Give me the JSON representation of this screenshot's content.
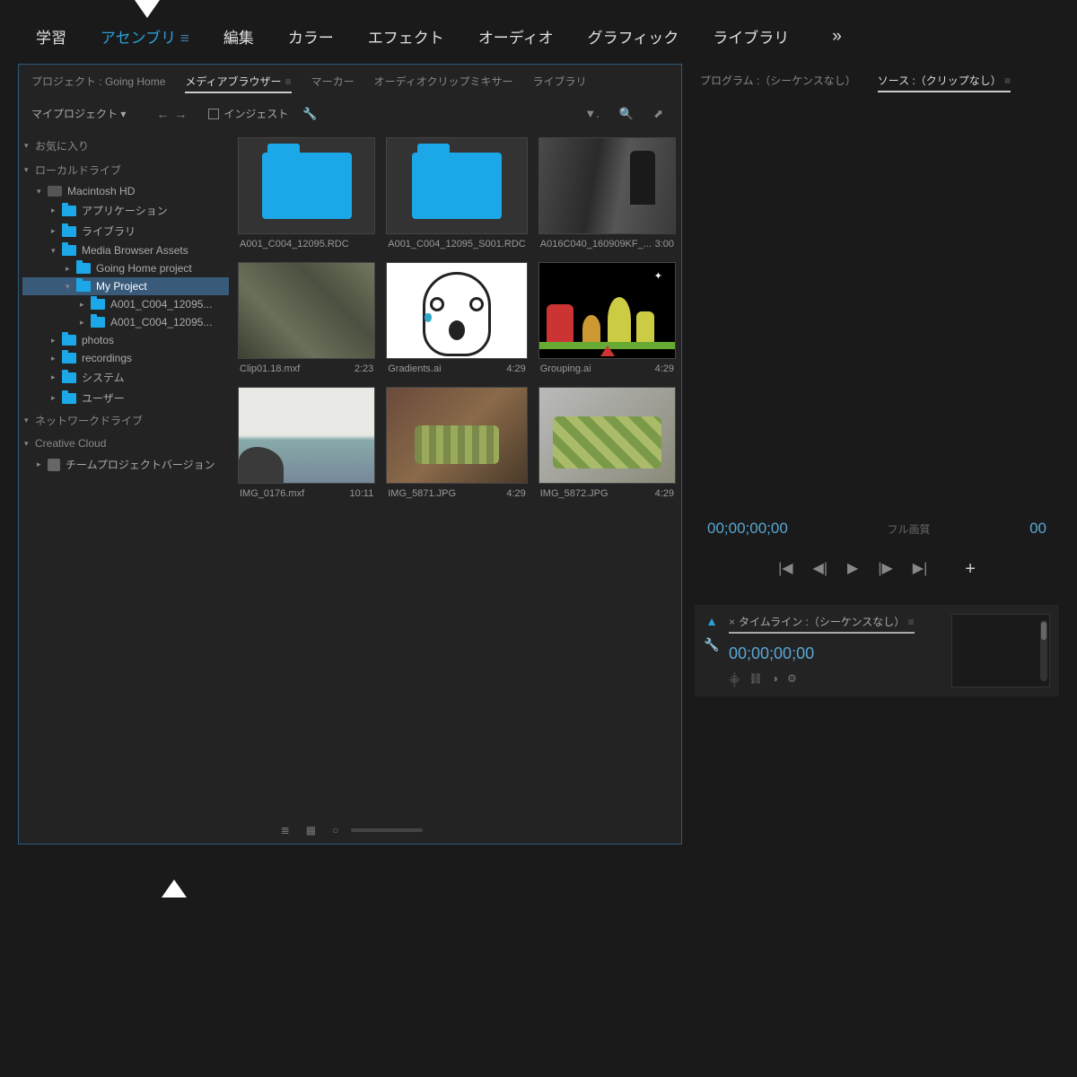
{
  "workspace": {
    "tabs": [
      "学習",
      "アセンブリ",
      "編集",
      "カラー",
      "エフェクト",
      "オーディオ",
      "グラフィック",
      "ライブラリ"
    ],
    "active_index": 1,
    "more": "»"
  },
  "panel_tabs": {
    "project_prefix": "プロジェクト :",
    "project_name": "Going Home",
    "media_browser": "メディアブラウザー",
    "markers": "マーカー",
    "audio_clip_mixer": "オーディオクリップミキサー",
    "libraries": "ライブラリ"
  },
  "toolbar": {
    "dropdown": "マイプロジェクト",
    "back": "←",
    "forward": "→",
    "ingest": "インジェスト",
    "wrench": "🔧",
    "filter": "▼",
    "search": "🔍",
    "new": "⤴"
  },
  "tree": {
    "favorites": "お気に入り",
    "local_drives": "ローカルドライブ",
    "drive": "Macintosh HD",
    "apps": "アプリケーション",
    "library": "ライブラリ",
    "media_assets": "Media Browser Assets",
    "going_home": "Going Home project",
    "my_project": "My Project",
    "sub1": "A001_C004_12095...",
    "sub2": "A001_C004_12095...",
    "photos": "photos",
    "recordings": "recordings",
    "system": "システム",
    "users": "ユーザー",
    "network": "ネットワークドライブ",
    "creative_cloud": "Creative Cloud",
    "team_project": "チームプロジェクトバージョン"
  },
  "items": [
    {
      "name": "A001_C004_12095.RDC",
      "dur": "",
      "kind": "folder"
    },
    {
      "name": "A001_C004_12095_S001.RDC",
      "dur": "",
      "kind": "folder"
    },
    {
      "name": "A016C040_160909KF_...",
      "dur": "3:00",
      "kind": "dark"
    },
    {
      "name": "Clip01.18.mxf",
      "dur": "2:23",
      "kind": "plants"
    },
    {
      "name": "Gradients.ai",
      "dur": "4:29",
      "kind": "ghost"
    },
    {
      "name": "Grouping.ai",
      "dur": "4:29",
      "kind": "cartoon"
    },
    {
      "name": "IMG_0176.mxf",
      "dur": "10:11",
      "kind": "beach"
    },
    {
      "name": "IMG_5871.JPG",
      "dur": "4:29",
      "kind": "food1"
    },
    {
      "name": "IMG_5872.JPG",
      "dur": "4:29",
      "kind": "food2"
    }
  ],
  "footer": {
    "list": "≣",
    "icon": "▦",
    "slider": "○"
  },
  "right": {
    "program_tab": "プログラム :（シーケンスなし）",
    "source_tab": "ソース :（クリップなし）",
    "timecode": "00;00;00;00",
    "fit": "フル画質",
    "end_tc": "00",
    "transport": {
      "inpoint": "|◀",
      "prev": "◀|",
      "play": "▶",
      "next": "|▶",
      "outpoint": "▶|",
      "plus": "+"
    }
  },
  "timeline": {
    "tab": "タイムライン :（シーケンスなし）",
    "timecode": "00;00;00;00",
    "tools": {
      "select": "▲",
      "wrench": "🔧"
    }
  }
}
